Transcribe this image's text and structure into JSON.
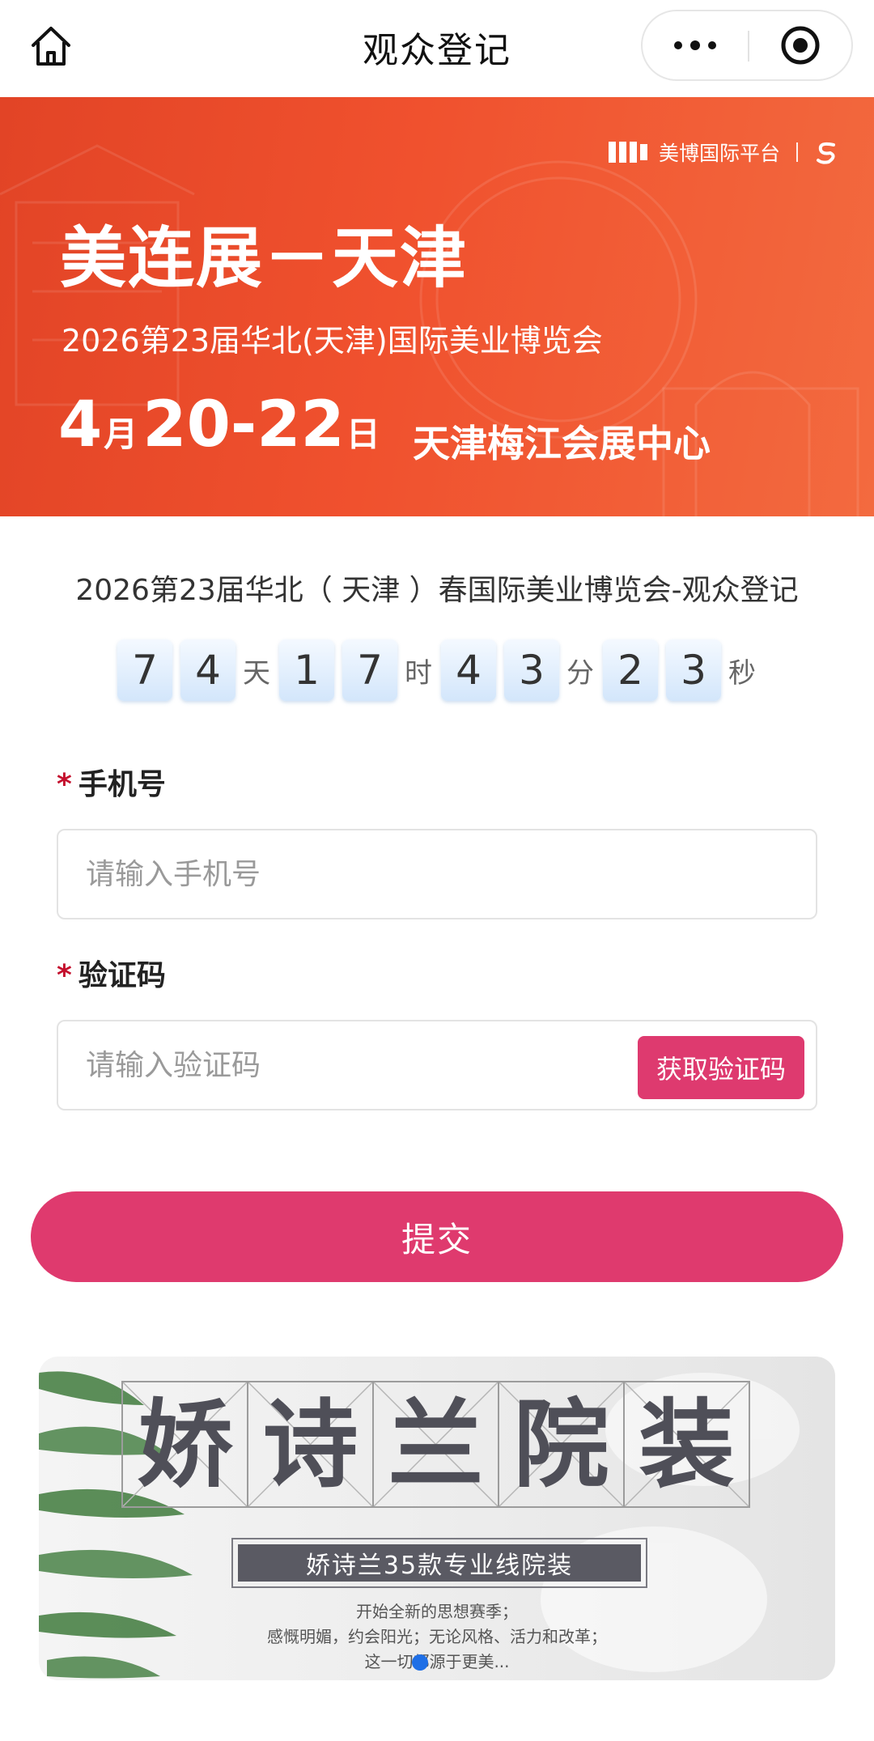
{
  "nav": {
    "title": "观众登记"
  },
  "banner": {
    "brand": "美博国际平台",
    "title": "美连展－天津",
    "subtitle": "2026第23届华北(天津)国际美业博览会",
    "date_month": "4",
    "date_month_suffix": "月",
    "date_days": "20-22",
    "date_day_suffix": "日",
    "venue": "天津梅江会展中心"
  },
  "event": {
    "title": "2026第23届华北（ 天津 ）春国际美业博览会-观众登记"
  },
  "countdown": {
    "days": [
      "7",
      "4"
    ],
    "days_unit": "天",
    "hours": [
      "1",
      "7"
    ],
    "hours_unit": "时",
    "minutes": [
      "4",
      "3"
    ],
    "minutes_unit": "分",
    "seconds": [
      "2",
      "3"
    ],
    "seconds_unit": "秒"
  },
  "form": {
    "phone_required": "*",
    "phone_label": "手机号",
    "phone_placeholder": "请输入手机号",
    "phone_value": "",
    "code_required": "*",
    "code_label": "验证码",
    "code_placeholder": "请输入验证码",
    "code_value": "",
    "get_code_label": "获取验证码",
    "submit_label": "提交"
  },
  "ad": {
    "chars": [
      "娇",
      "诗",
      "兰",
      "院",
      "装"
    ],
    "tagline": "娇诗兰35款专业线院装",
    "lines": [
      "开始全新的思想赛季；",
      "感慨明媚，约会阳光；无论风格、活力和改革；",
      "这一切都源于更美..."
    ]
  },
  "colors": {
    "accent": "#de3a6f",
    "banner_red": "#ef4f2c",
    "required_star": "#c40f2d",
    "carousel_dot": "#1f6fe6"
  }
}
